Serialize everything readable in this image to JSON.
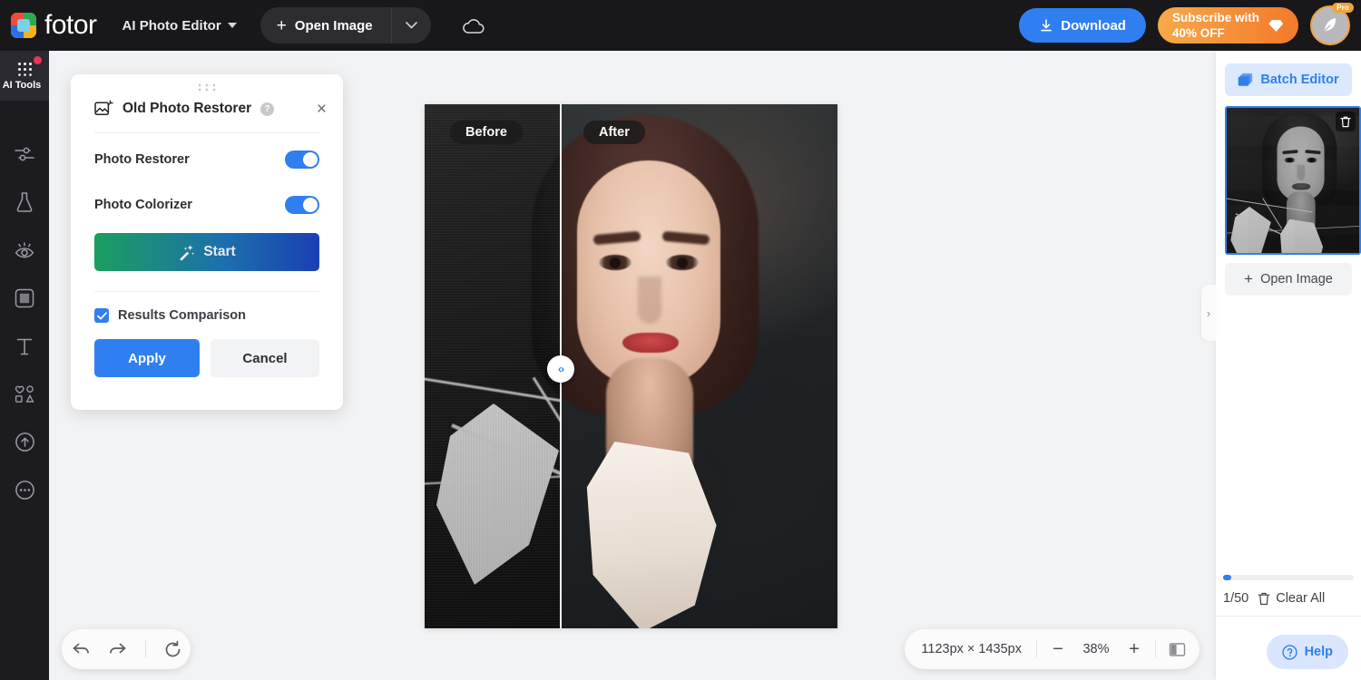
{
  "header": {
    "brand": "fotor",
    "app_menu": "AI Photo Editor",
    "open_image": "Open Image",
    "download": "Download",
    "subscribe_line1": "Subscribe with",
    "subscribe_line2": "40% OFF",
    "pro_badge": "Pro",
    "icons": {
      "plus": "+",
      "chevron_down": "chevron-down-icon",
      "cloud": "cloud-icon",
      "download": "download-icon",
      "diamond": "diamond-icon"
    }
  },
  "sidebar": {
    "active_label": "AI Tools",
    "items": [
      {
        "name": "ai-tools",
        "label": "AI Tools",
        "badge": true
      },
      {
        "name": "adjust",
        "label": "Adjust"
      },
      {
        "name": "retouch",
        "label": "Retouch"
      },
      {
        "name": "effects",
        "label": "Effects"
      },
      {
        "name": "frame",
        "label": "Frame"
      },
      {
        "name": "text",
        "label": "Text"
      },
      {
        "name": "elements",
        "label": "Elements"
      },
      {
        "name": "upload",
        "label": "Upload"
      },
      {
        "name": "more",
        "label": "More"
      }
    ]
  },
  "tool_panel": {
    "title": "Old Photo Restorer",
    "help_glyph": "?",
    "close_glyph": "×",
    "rows": [
      {
        "label": "Photo Restorer",
        "enabled": true
      },
      {
        "label": "Photo Colorizer",
        "enabled": true
      }
    ],
    "start_label": "Start",
    "comparison_label": "Results Comparison",
    "comparison_checked": true,
    "apply_label": "Apply",
    "cancel_label": "Cancel"
  },
  "canvas": {
    "before_label": "Before",
    "after_label": "After",
    "handle_glyph": "‹›"
  },
  "bottom_bar": {
    "undo": "undo-icon",
    "redo": "redo-icon",
    "reset": "reset-icon",
    "dimensions": "1123px × 1435px",
    "zoom_out": "−",
    "zoom_value": "38%",
    "zoom_in": "+",
    "fit_icon": "compare-view-icon"
  },
  "right_panel": {
    "batch_editor": "Batch Editor",
    "open_image": "Open Image",
    "counter": "1/50",
    "clear_all": "Clear All",
    "help": "Help",
    "collapse_glyph": "›"
  },
  "colors": {
    "accent_blue": "#2f7ff0",
    "header_bg": "#18181b",
    "rail_bg": "#1c1c20",
    "orange_start": "#f7a94a",
    "orange_end": "#f3792a",
    "start_green": "#1b9e5f",
    "start_blue": "#1b3fb2",
    "canvas_bg": "#f2f3f5"
  }
}
